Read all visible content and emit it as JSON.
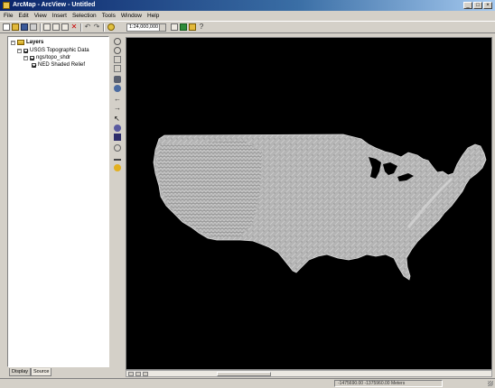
{
  "window": {
    "title": "ArcMap - ArcView - Untitled",
    "controls": [
      "_",
      "□",
      "×"
    ]
  },
  "menu": [
    "File",
    "Edit",
    "View",
    "Insert",
    "Selection",
    "Tools",
    "Window",
    "Help"
  ],
  "toolbar": {
    "scale": "1:24,000,000"
  },
  "toc": {
    "root": "Layers",
    "group": "USGS Topographic Data",
    "layer": "ngs/topo_shdr",
    "sublayer": "NED Shaded Relief"
  },
  "tabs": [
    "Display",
    "Source"
  ],
  "status": {
    "coordinates": "-1475690.00  -1375960.00 Meters"
  },
  "colors": {
    "map_background": "#000000",
    "relief": "#b8b8b8",
    "chrome": "#d4d0c8",
    "titlebar": "#0a246a"
  },
  "icons": {
    "toolbar": [
      "new-icon",
      "open-icon",
      "save-icon",
      "print-icon",
      "cut-icon",
      "copy-icon",
      "paste-icon",
      "delete-icon",
      "undo-icon",
      "redo-icon",
      "add-data-icon",
      "editor-icon",
      "arctoolbox-icon",
      "identify-icon"
    ],
    "tools": [
      "zoom-in-icon",
      "zoom-out-icon",
      "fixed-zoom-in-icon",
      "fixed-zoom-out-icon",
      "pan-icon",
      "full-extent-icon",
      "back-extent-icon",
      "forward-extent-icon",
      "select-features-icon",
      "select-elements-icon",
      "identify-tool-icon",
      "find-icon",
      "measure-icon",
      "hyperlink-icon"
    ]
  }
}
